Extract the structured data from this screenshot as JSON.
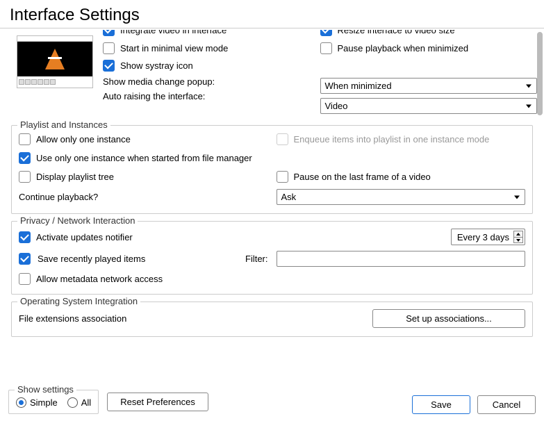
{
  "title": "Interface Settings",
  "top": {
    "integrate_video": {
      "label": "Integrate video in interface",
      "checked": true
    },
    "resize_interface": {
      "label": "Resize interface to video size",
      "checked": true
    },
    "start_minimal": {
      "label": "Start in minimal view mode",
      "checked": false
    },
    "pause_minimized": {
      "label": "Pause playback when minimized",
      "checked": false
    },
    "show_systray": {
      "label": "Show systray icon",
      "checked": true
    },
    "media_popup_label": "Show media change popup:",
    "media_popup_value": "When minimized",
    "auto_raise_label": "Auto raising the interface:",
    "auto_raise_value": "Video"
  },
  "playlist": {
    "title": "Playlist and Instances",
    "one_instance": {
      "label": "Allow only one instance",
      "checked": false
    },
    "enqueue": {
      "label": "Enqueue items into playlist in one instance mode",
      "checked": false,
      "disabled": true
    },
    "one_instance_fm": {
      "label": "Use only one instance when started from file manager",
      "checked": true
    },
    "playlist_tree": {
      "label": "Display playlist tree",
      "checked": false
    },
    "pause_last_frame": {
      "label": "Pause on the last frame of a video",
      "checked": false
    },
    "continue_label": "Continue playback?",
    "continue_value": "Ask"
  },
  "privacy": {
    "title": "Privacy / Network Interaction",
    "updates": {
      "label": "Activate updates notifier",
      "checked": true
    },
    "updates_value": "Every 3 days",
    "recent": {
      "label": "Save recently played items",
      "checked": true
    },
    "filter_label": "Filter:",
    "filter_value": "",
    "metadata": {
      "label": "Allow metadata network access",
      "checked": false
    }
  },
  "os": {
    "title": "Operating System Integration",
    "file_ext_label": "File extensions association",
    "setup_btn": "Set up associations..."
  },
  "footer": {
    "show_settings_title": "Show settings",
    "simple": "Simple",
    "all": "All",
    "selected": "simple",
    "reset": "Reset Preferences",
    "save": "Save",
    "cancel": "Cancel"
  }
}
